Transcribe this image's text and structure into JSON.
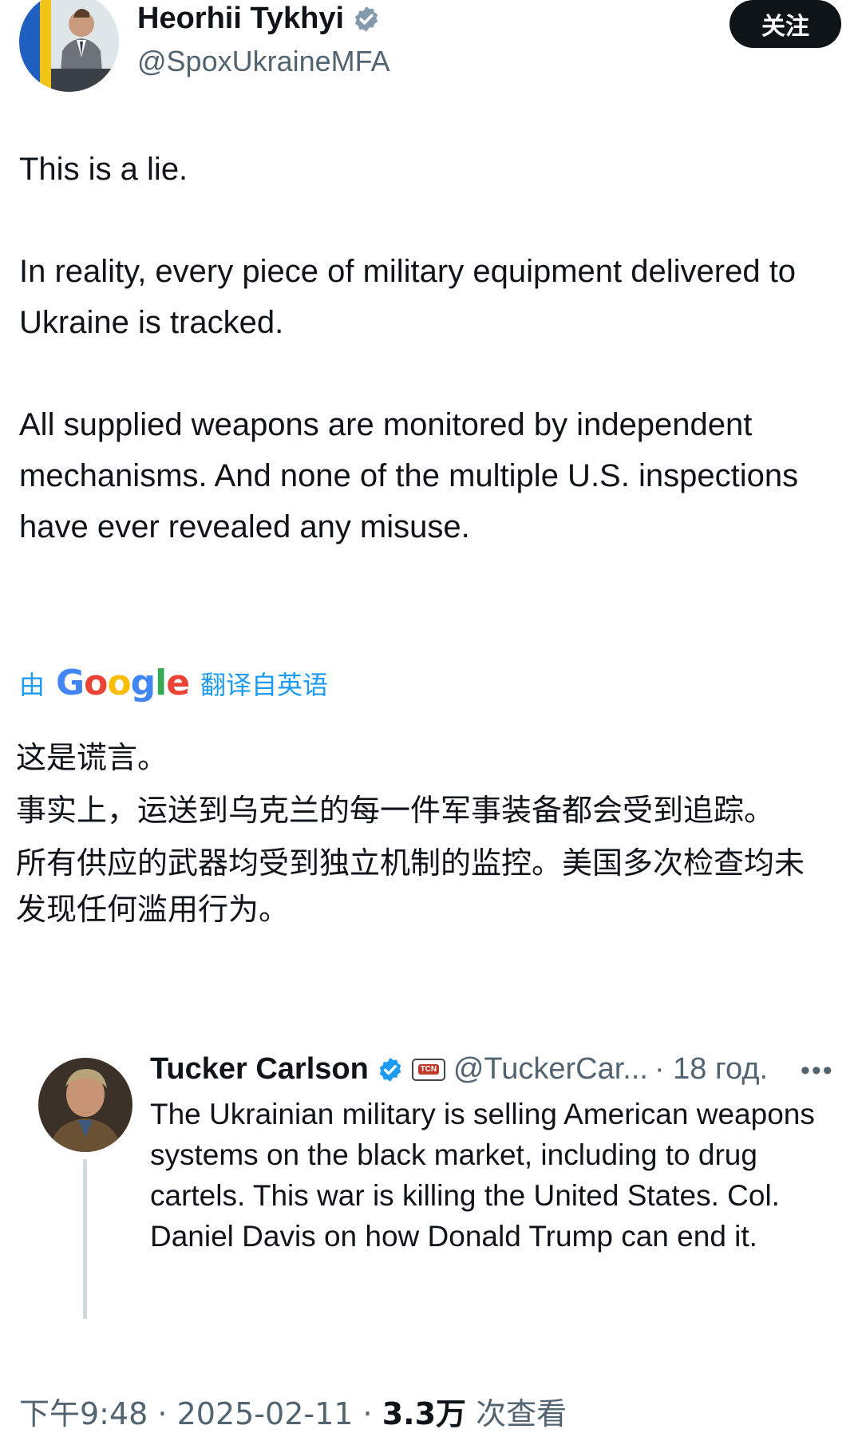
{
  "author": {
    "name": "Heorhii Tykhyi",
    "handle": "@SpoxUkraineMFA",
    "verified_color": "#829aab"
  },
  "follow_label": "关注",
  "post": {
    "paragraphs": [
      "This is a lie.",
      "In reality, every piece of military equipment delivered to Ukraine is tracked.",
      "All supplied weapons are monitored by independent mechanisms. And none of the multiple U.S. inspections have ever revealed any misuse."
    ]
  },
  "translation": {
    "prefix": "由",
    "provider": "Google",
    "suffix": "翻译自英语",
    "paragraphs": [
      "这是谎言。",
      "事实上，运送到乌克兰的每一件军事装备都会受到追踪。",
      "所有供应的武器均受到独立机制的监控。美国多次检查均未发现任何滥用行为。"
    ]
  },
  "quoted_post": {
    "name": "Tucker Carlson",
    "badge": "TCN",
    "handle": "@TuckerCar...",
    "time": "· 18 год.",
    "more": "•••",
    "text": "The Ukrainian military is selling American weapons systems on the black market, including to drug cartels. This war is killing the United States. Col. Daniel Davis on how Donald Trump can end it.",
    "verified_color": "#1d9bf0"
  },
  "meta": {
    "time": "下午9:48",
    "sep1": " · ",
    "date": "2025-02-11",
    "sep2": " · ",
    "views": "3.3万",
    "views_label": " 次查看"
  }
}
